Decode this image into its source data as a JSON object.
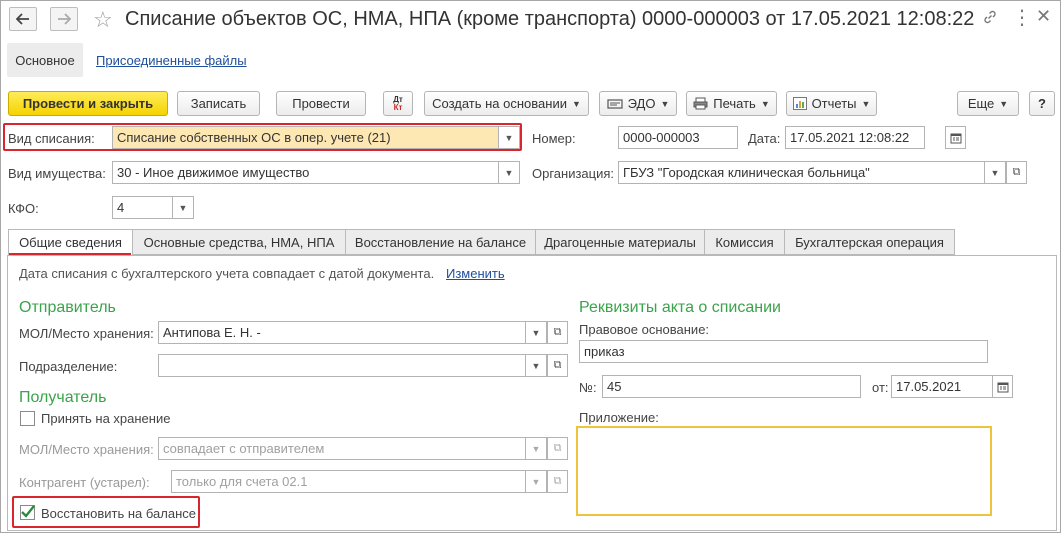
{
  "window": {
    "title": "Списание объектов ОС, НМА, НПА (кроме транспорта) 0000-000003 от 17.05.2021 12:08:22"
  },
  "topnav": {
    "main": "Основное",
    "attachments": "Присоединенные файлы"
  },
  "toolbar": {
    "post_close": "Провести и закрыть",
    "save": "Записать",
    "post": "Провести",
    "dtkt_top": "Дт",
    "dtkt_bottom": "Кт",
    "create_based": "Создать на основании",
    "edo": "ЭДО",
    "print": "Печать",
    "reports": "Отчеты",
    "more": "Еще",
    "help": "?"
  },
  "header": {
    "write_off_type_label": "Вид списания:",
    "write_off_type_value": "Списание собственных ОС в опер. учете (21)",
    "number_label": "Номер:",
    "number_value": "0000-000003",
    "date_label": "Дата:",
    "date_value": "17.05.2021 12:08:22",
    "property_type_label": "Вид имущества:",
    "property_type_value": "30 - Иное движимое имущество",
    "organization_label": "Организация:",
    "organization_value": "ГБУЗ \"Городская клиническая больница\"",
    "kfo_label": "КФО:",
    "kfo_value": "4"
  },
  "tabs": [
    {
      "label": "Общие сведения"
    },
    {
      "label": "Основные средства, НМА, НПА"
    },
    {
      "label": "Восстановление на балансе"
    },
    {
      "label": "Драгоценные материалы"
    },
    {
      "label": "Комиссия"
    },
    {
      "label": "Бухгалтерская операция"
    }
  ],
  "general": {
    "info_text": "Дата списания с бухгалтерского учета совпадает с датой документа.",
    "change_link": "Изменить",
    "sender_title": "Отправитель",
    "mol_label": "МОЛ/Место хранения:",
    "mol_value": "Антипова Е. Н. -",
    "department_label": "Подразделение:",
    "department_value": "",
    "recipient_title": "Получатель",
    "accept_storage_label": "Принять на хранение",
    "recipient_mol_label": "МОЛ/Место хранения:",
    "recipient_mol_placeholder": "совпадает с отправителем",
    "counterparty_label": "Контрагент (устарел):",
    "counterparty_placeholder": "только для счета 02.1",
    "restore_label": "Восстановить на балансе",
    "act_title": "Реквизиты акта о списании",
    "legal_basis_label": "Правовое основание:",
    "legal_basis_value": "приказ",
    "act_number_label": "№:",
    "act_number_value": "45",
    "act_date_label": "от:",
    "act_date_value": "17.05.2021",
    "attachment_label": "Приложение:",
    "attachment_value": ""
  }
}
